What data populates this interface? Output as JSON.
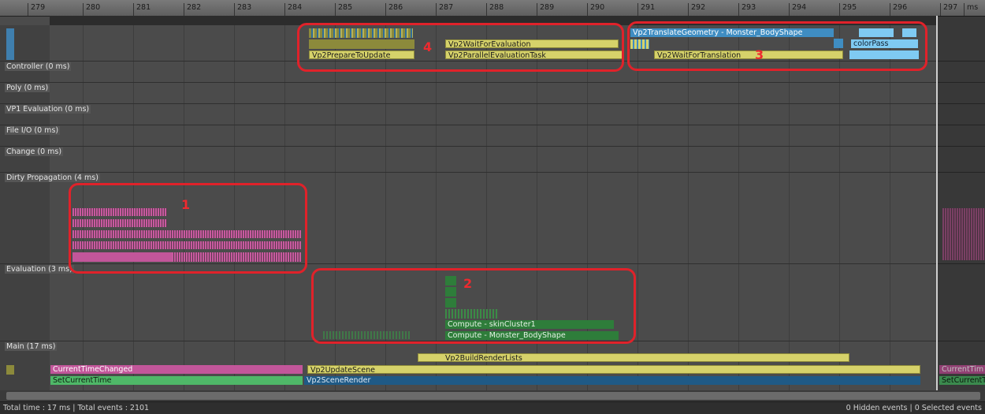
{
  "ruler": {
    "ticks": [
      "279",
      "280",
      "281",
      "282",
      "283",
      "284",
      "285",
      "286",
      "287",
      "288",
      "289",
      "290",
      "291",
      "292",
      "293",
      "294",
      "295",
      "296",
      "297"
    ],
    "unit": "ms"
  },
  "lanes": {
    "controller": "Controller (0 ms)",
    "poly": "Poly (0 ms)",
    "vp1": "VP1 Evaluation (0 ms)",
    "fileio": "File I/O (0 ms)",
    "change": "Change (0 ms)",
    "dirty": "Dirty Propagation (4 ms)",
    "evaluation": "Evaluation (3 ms)",
    "main": "Main (17 ms)"
  },
  "events": {
    "translate_geometry": "Vp2TranslateGeometry - Monster_BodyShape",
    "color_pass": "colorPass",
    "wait_translation": "Vp2WaitForTranslation",
    "wait_evaluation": "Vp2WaitForEvaluation",
    "prepare_update": "Vp2PrepareToUpdate",
    "parallel_eval": "Vp2ParallelEvaluationTask",
    "skin_cluster": "Compute - skinCluster1",
    "body_shape": "Compute - Monster_BodyShape",
    "build_render_lists": "Vp2BuildRenderLists",
    "current_time_changed": "CurrentTimeChanged",
    "set_current_time": "SetCurrentTime",
    "update_scene": "Vp2UpdateScene",
    "scene_render": "Vp2SceneRender",
    "current_time_changed_trunc": "CurrentTim",
    "set_current_time_trunc": "SetCurrentT"
  },
  "annotations": [
    "1",
    "2",
    "3",
    "4"
  ],
  "status": {
    "left": "Total time : 17 ms | Total events : 2101",
    "right": "0 Hidden events | 0 Selected events"
  },
  "colors": {
    "yellow": "#d6d26a",
    "pink": "#c2569a",
    "green": "#4fb868",
    "navy": "#1f5a86",
    "blue": "#3f8dc2",
    "light_blue": "#7fcaf2",
    "dark_green": "#2e7d3a",
    "annotation": "#e0222a"
  }
}
